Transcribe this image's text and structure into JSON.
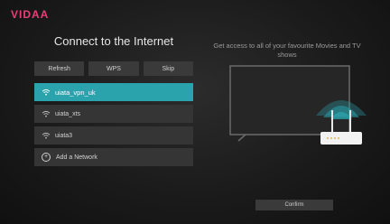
{
  "brand": {
    "logo_text": "VIDAA"
  },
  "header": {
    "title": "Connect to the Internet"
  },
  "actions": {
    "refresh": "Refresh",
    "wps": "WPS",
    "skip": "Skip"
  },
  "networks": [
    {
      "ssid": "uiata_vpn_uk",
      "selected": true
    },
    {
      "ssid": "uiata_xts",
      "selected": false
    },
    {
      "ssid": "uiata3",
      "selected": false
    }
  ],
  "add_network": {
    "label": "Add a Network"
  },
  "promo": {
    "text": "Get access to all of your favourite Movies and TV shows"
  },
  "footer": {
    "confirm_label": "Confirm"
  },
  "colors": {
    "accent": "#2aa3ad",
    "brand": "#e83e7a"
  },
  "icons": {
    "wifi": "wifi-icon",
    "add": "plus-circle-icon"
  }
}
